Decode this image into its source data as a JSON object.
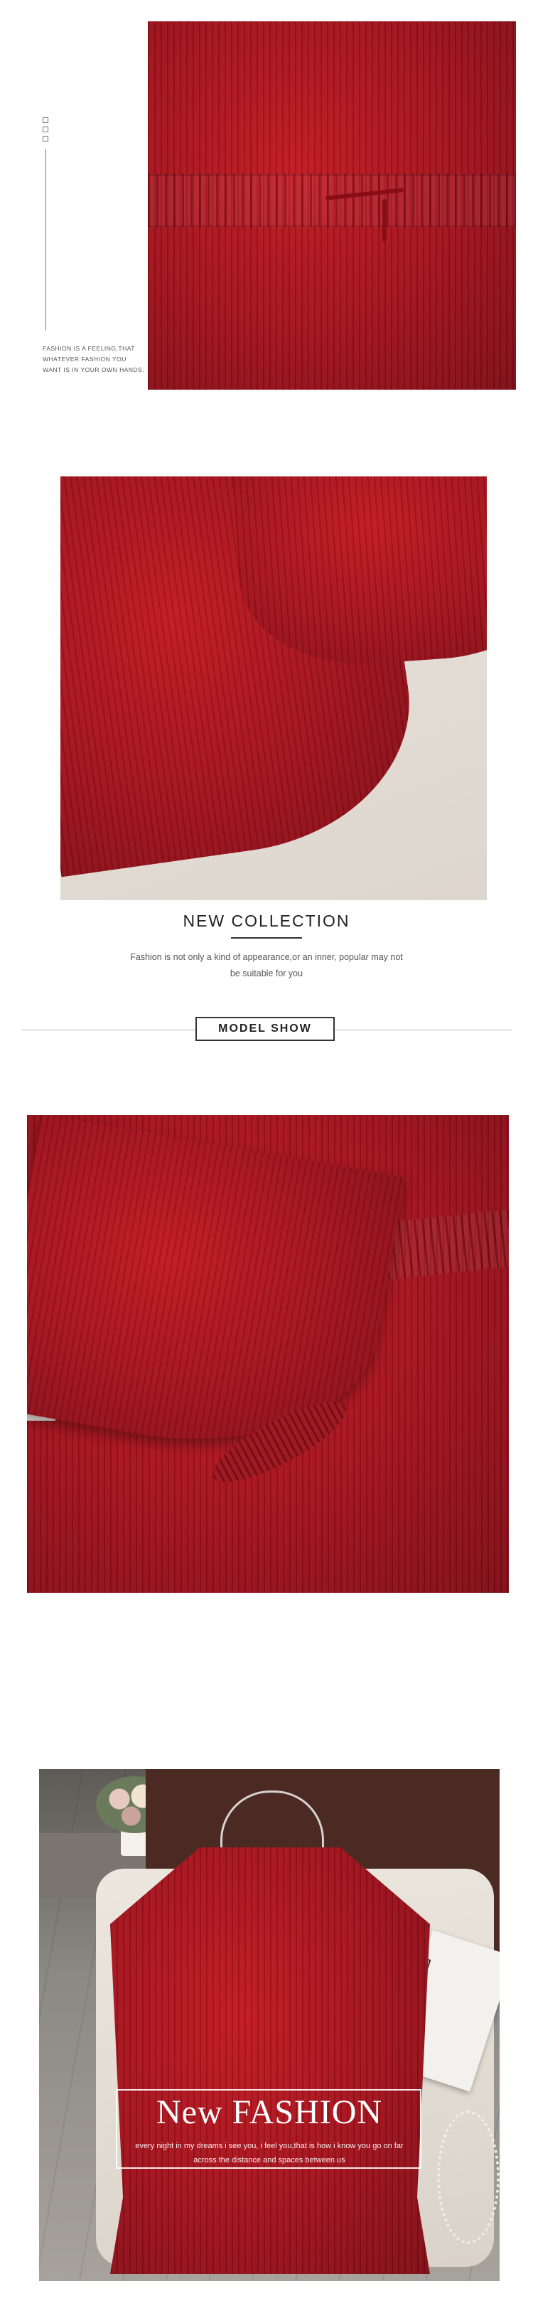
{
  "section1": {
    "note": "FASHION IS A FEELING,THAT WHATEVER FASHION YOU WANT IS IN YOUR OWN HANDS."
  },
  "collection": {
    "title": "NEW COLLECTION",
    "text": "Fashion is not only a kind of appearance,or an inner, popular may not be suitable for you"
  },
  "model_show": {
    "label": "MODEL SHOW"
  },
  "new_fashion": {
    "title": "New FASHION",
    "subtitle": "every night in my dreams i see you, i feel you,that is how i know you go on far across the distance and spaces between us",
    "magazine_text": "TIME"
  },
  "icons": [
    "square-icon",
    "square-icon",
    "square-icon"
  ],
  "colors": {
    "dress_red": "#a0101a",
    "text_dark": "#222222"
  }
}
